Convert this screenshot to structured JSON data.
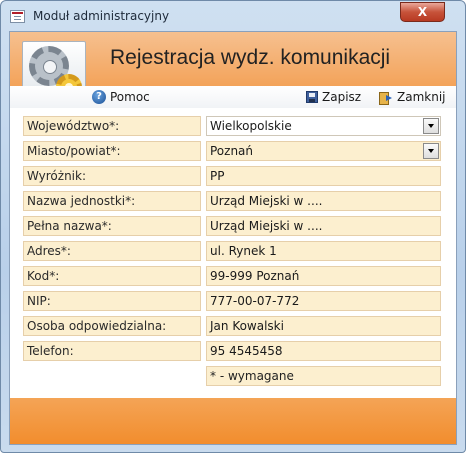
{
  "window": {
    "title": "Moduł administracyjny",
    "close_glyph": "X"
  },
  "header": {
    "title": "Rejestracja wydz. komunikacji",
    "logo_icon": "gears-icon"
  },
  "toolbar": {
    "help_label": "Pomoc",
    "help_icon": "question-icon",
    "save_label": "Zapisz",
    "save_icon": "floppy-disk-icon",
    "close_label": "Zamknij",
    "close_icon": "exit-door-icon"
  },
  "fields": [
    {
      "label": "Województwo*:",
      "value": "Wielkopolskie",
      "type": "dropdown"
    },
    {
      "label": "Miasto/powiat*:",
      "value": "Poznań",
      "type": "dropdown"
    },
    {
      "label": "Wyróżnik:",
      "value": "PP",
      "type": "text"
    },
    {
      "label": "Nazwa jednostki*:",
      "value": "Urząd Miejski w ....",
      "type": "text"
    },
    {
      "label": "Pełna nazwa*:",
      "value": "Urząd Miejski w ....",
      "type": "text"
    },
    {
      "label": "Adres*:",
      "value": "ul. Rynek 1",
      "type": "text"
    },
    {
      "label": "Kod*:",
      "value": "99-999 Poznań",
      "type": "text"
    },
    {
      "label": "NIP:",
      "value": "777-00-07-772",
      "type": "text"
    },
    {
      "label": "Osoba odpowiedzialna:",
      "value": "Jan Kowalski",
      "type": "text"
    },
    {
      "label": "Telefon:",
      "value": "95 4545458",
      "type": "text"
    }
  ],
  "required_note": "* - wymagane",
  "colors": {
    "header_orange": "#f3a35a",
    "field_bg": "#fcefcf",
    "footer_orange": "#f28d2d"
  }
}
